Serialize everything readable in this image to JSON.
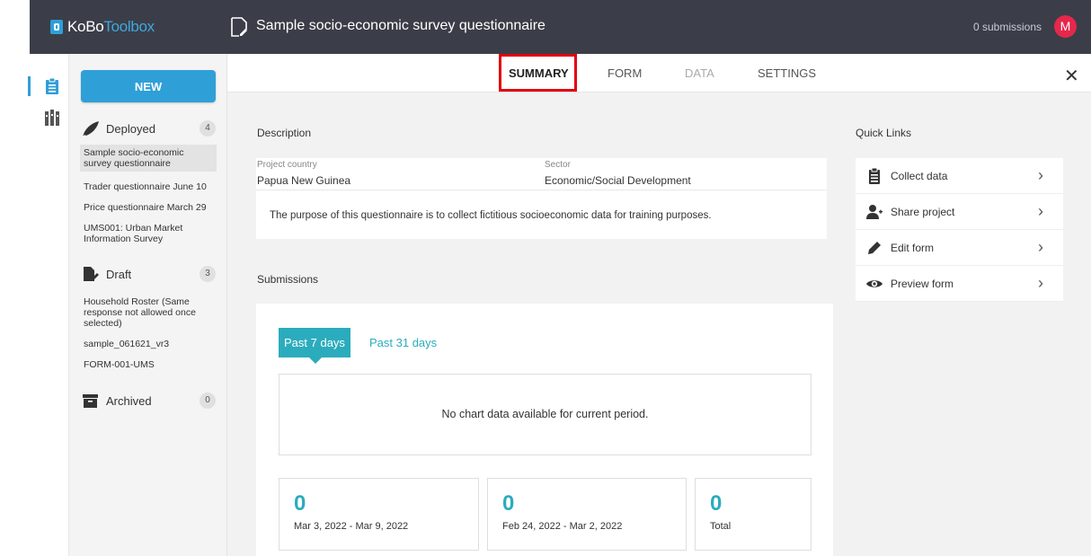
{
  "header": {
    "logo_prefix": "KoBo",
    "logo_suffix": "Toolbox",
    "project_title": "Sample socio-economic survey questionnaire",
    "submissions_count": "0 submissions",
    "avatar_initial": "M",
    "colors": {
      "bar": "#3b3e48",
      "brand": "#2f9fd8",
      "avatar": "#e6274c"
    }
  },
  "rail": {
    "icons": [
      "forms-icon",
      "library-icon"
    ]
  },
  "sidebar": {
    "new_label": "NEW",
    "deployed": {
      "label": "Deployed",
      "count": "4"
    },
    "deployed_items": [
      "Sample socio-economic survey questionnaire",
      "Trader questionnaire June 10",
      "Price questionnaire March 29",
      "UMS001: Urban Market Information Survey"
    ],
    "draft": {
      "label": "Draft",
      "count": "3"
    },
    "draft_items": [
      "Household Roster (Same response not allowed once selected)",
      "sample_061621_vr3",
      "FORM-001-UMS"
    ],
    "archived": {
      "label": "Archived",
      "count": "0"
    }
  },
  "tabs": {
    "summary": "SUMMARY",
    "form": "FORM",
    "data": "DATA",
    "settings": "SETTINGS",
    "close": "✕"
  },
  "description": {
    "heading": "Description",
    "country_label": "Project country",
    "country_value": "Papua New Guinea",
    "sector_label": "Sector",
    "sector_value": "Economic/Social Development",
    "text": "The purpose of this questionnaire is to collect fictitious socioeconomic data for training purposes."
  },
  "submissions": {
    "heading": "Submissions",
    "period_active": "Past 7 days",
    "period_other": "Past 31 days",
    "empty_message": "No chart data available for current period.",
    "stats": [
      {
        "value": "0",
        "label": "Mar 3, 2022 - Mar 9, 2022"
      },
      {
        "value": "0",
        "label": "Feb 24, 2022 - Mar 2, 2022"
      },
      {
        "value": "0",
        "label": "Total"
      }
    ],
    "accent": "#2bacbd"
  },
  "quick_links": {
    "heading": "Quick Links",
    "items": [
      {
        "label": "Collect data",
        "icon": "clipboard-icon"
      },
      {
        "label": "Share project",
        "icon": "add-user-icon"
      },
      {
        "label": "Edit form",
        "icon": "pencil-icon"
      },
      {
        "label": "Preview form",
        "icon": "eye-icon"
      }
    ],
    "chevron": "›"
  }
}
